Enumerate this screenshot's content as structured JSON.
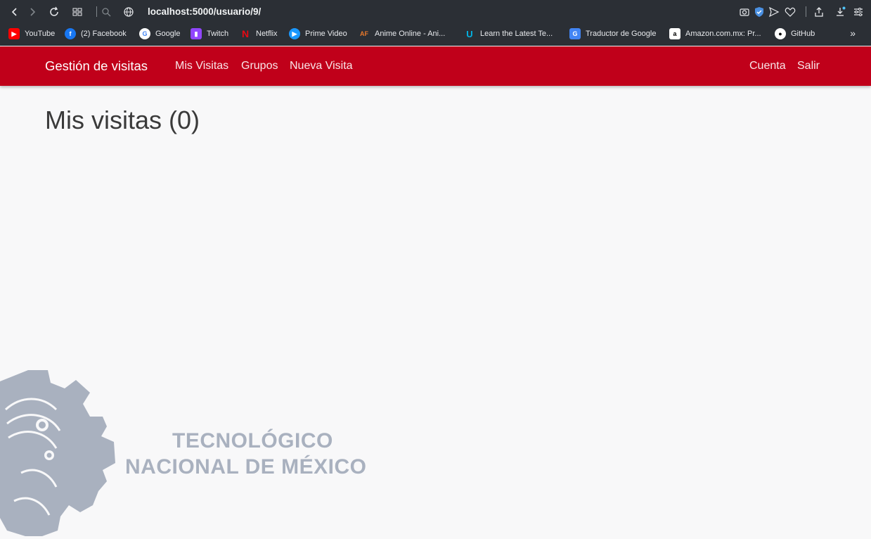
{
  "browser": {
    "url": "localhost:5000/usuario/9/",
    "bookmarks": [
      {
        "label": "YouTube",
        "icon": "youtube-icon",
        "color": "#ff0000"
      },
      {
        "label": "(2) Facebook",
        "icon": "facebook-icon",
        "color": "#1877f2"
      },
      {
        "label": "Google",
        "icon": "google-icon",
        "color": "#ffffff"
      },
      {
        "label": "Twitch",
        "icon": "twitch-icon",
        "color": "#9146ff"
      },
      {
        "label": "Netflix",
        "icon": "netflix-icon",
        "color": "#e50914"
      },
      {
        "label": "Prime Video",
        "icon": "prime-video-icon",
        "color": "#1a98ff"
      },
      {
        "label": "Anime Online - Ani...",
        "icon": "animeflv-icon",
        "color": "#e8792b"
      },
      {
        "label": "Learn the Latest Te...",
        "icon": "udacity-icon",
        "color": "#02b3e4"
      },
      {
        "label": "Traductor de Google",
        "icon": "google-translate-icon",
        "color": "#4285f4"
      },
      {
        "label": "Amazon.com.mx: Pr...",
        "icon": "amazon-icon",
        "color": "#ffffff"
      },
      {
        "label": "GitHub",
        "icon": "github-icon",
        "color": "#ffffff"
      }
    ]
  },
  "navbar": {
    "brand": "Gestión de visitas",
    "links": [
      "Mis Visitas",
      "Grupos",
      "Nueva Visita"
    ],
    "right_links": [
      "Cuenta",
      "Salir"
    ],
    "color": "#c0001a"
  },
  "main": {
    "title": "Mis visitas (0)"
  },
  "logo": {
    "line1": "TECNOLÓGICO",
    "line2": "NACIONAL DE MÉXICO",
    "color": "#a9b1bf"
  }
}
